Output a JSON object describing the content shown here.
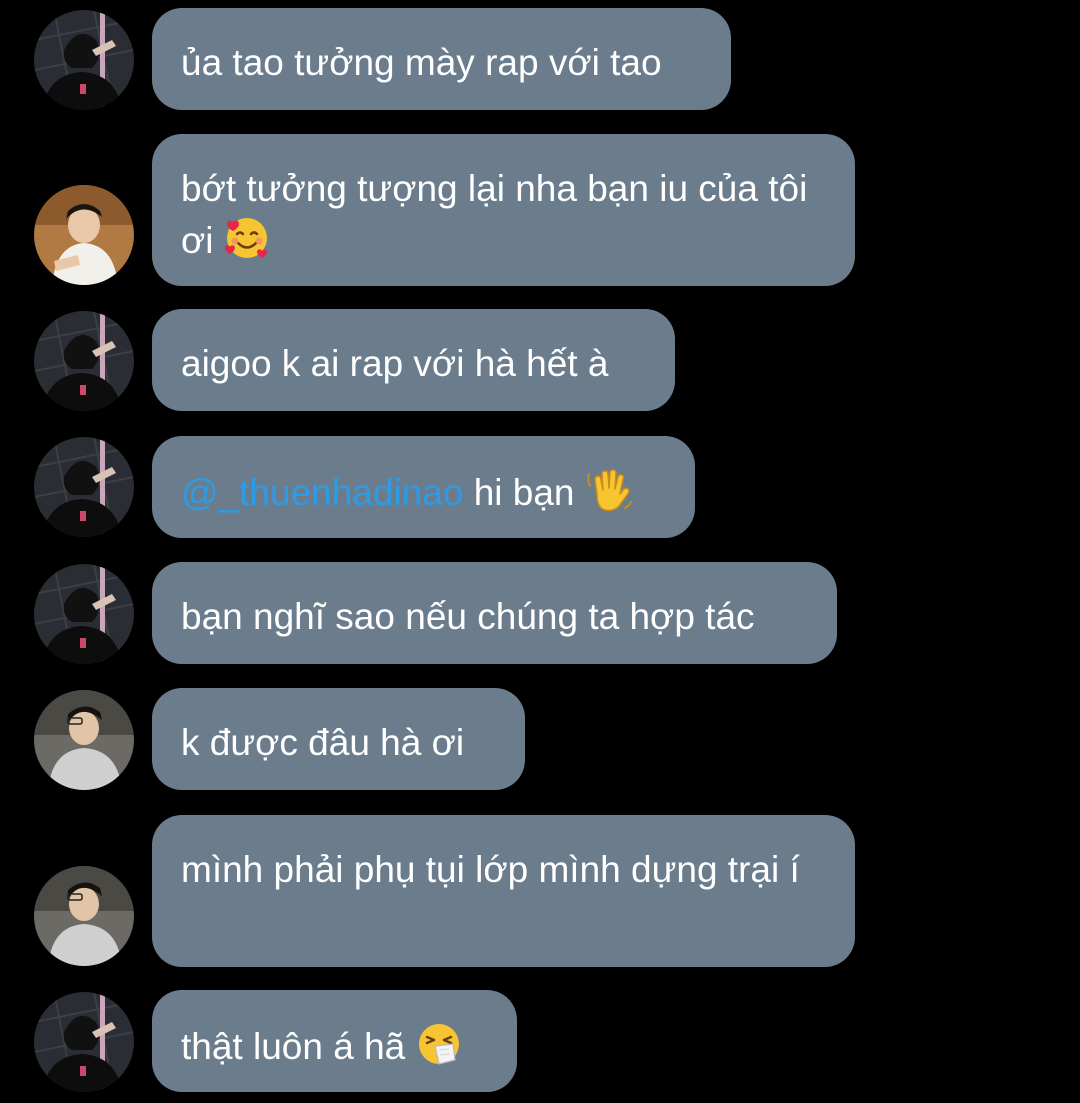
{
  "messages": [
    {
      "avatar": "avatar-ha",
      "text": "ủa tao tưởng mày rap với tao"
    },
    {
      "avatar": "avatar-friend-white-shirt",
      "text": "bớt tưởng tượng lại nha bạn iu của tôi ơi",
      "emoji": "smiling-face-with-hearts-icon"
    },
    {
      "avatar": "avatar-ha",
      "text": "aigoo k ai rap với hà hết à"
    },
    {
      "avatar": "avatar-ha",
      "mention": "@_thuenhadinao",
      "text": "hi bạn",
      "emoji": "waving-hand-icon"
    },
    {
      "avatar": "avatar-ha",
      "text": "bạn nghĩ sao nếu chúng ta hợp tác"
    },
    {
      "avatar": "avatar-friend-grey-hoodie",
      "text": "k được đâu hà ơi"
    },
    {
      "avatar": "avatar-friend-grey-hoodie",
      "text": "mình phải phụ tụi lớp mình dựng trại í"
    },
    {
      "avatar": "avatar-ha",
      "text": "thật luôn á hã",
      "emoji": "sneezing-face-icon"
    }
  ],
  "colors": {
    "background": "#000000",
    "bubble": "#6b7c8c",
    "text": "#ffffff",
    "mention": "#2e9be6"
  }
}
